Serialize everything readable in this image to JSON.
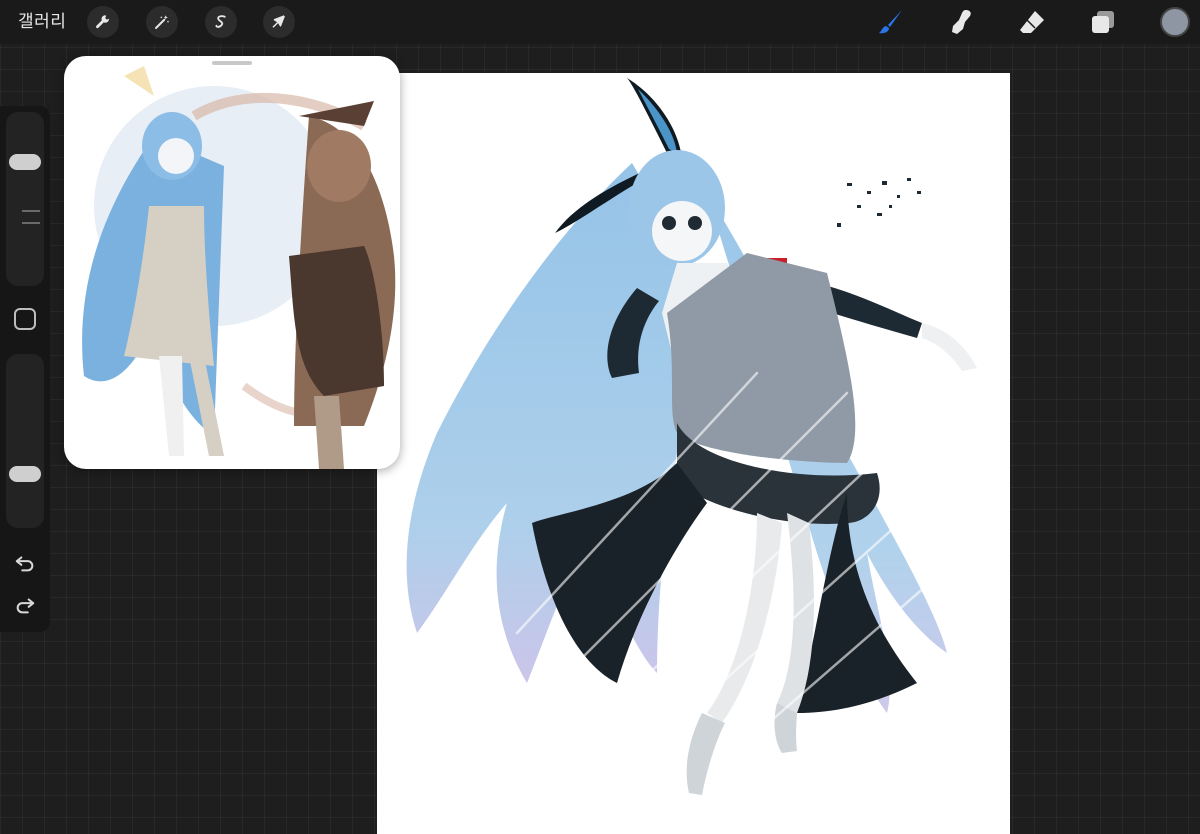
{
  "toolbar": {
    "gallery_label": "갤러리",
    "left_tools": [
      {
        "name": "actions",
        "icon": "wrench-icon"
      },
      {
        "name": "adjustments",
        "icon": "magic-wand-icon"
      },
      {
        "name": "selection",
        "icon": "selection-s-icon"
      },
      {
        "name": "transform",
        "icon": "arrow-cursor-icon"
      }
    ],
    "right_tools": [
      {
        "name": "brush",
        "icon": "brush-icon",
        "active": true
      },
      {
        "name": "smudge",
        "icon": "smudge-finger-icon"
      },
      {
        "name": "eraser",
        "icon": "eraser-icon"
      },
      {
        "name": "layers",
        "icon": "layers-icon"
      }
    ],
    "current_color": "#8e96a3",
    "active_color": "#2a74e8"
  },
  "sidebar": {
    "brush_size_level": 0.75,
    "opacity_level": 0.28,
    "undo_icon": "undo-icon",
    "redo_icon": "redo-icon",
    "modify_icon": "square-modify-icon"
  },
  "canvas": {
    "background": "#ffffff",
    "artwork": "character-illustration"
  },
  "reference": {
    "artwork": "reference-illustration"
  }
}
